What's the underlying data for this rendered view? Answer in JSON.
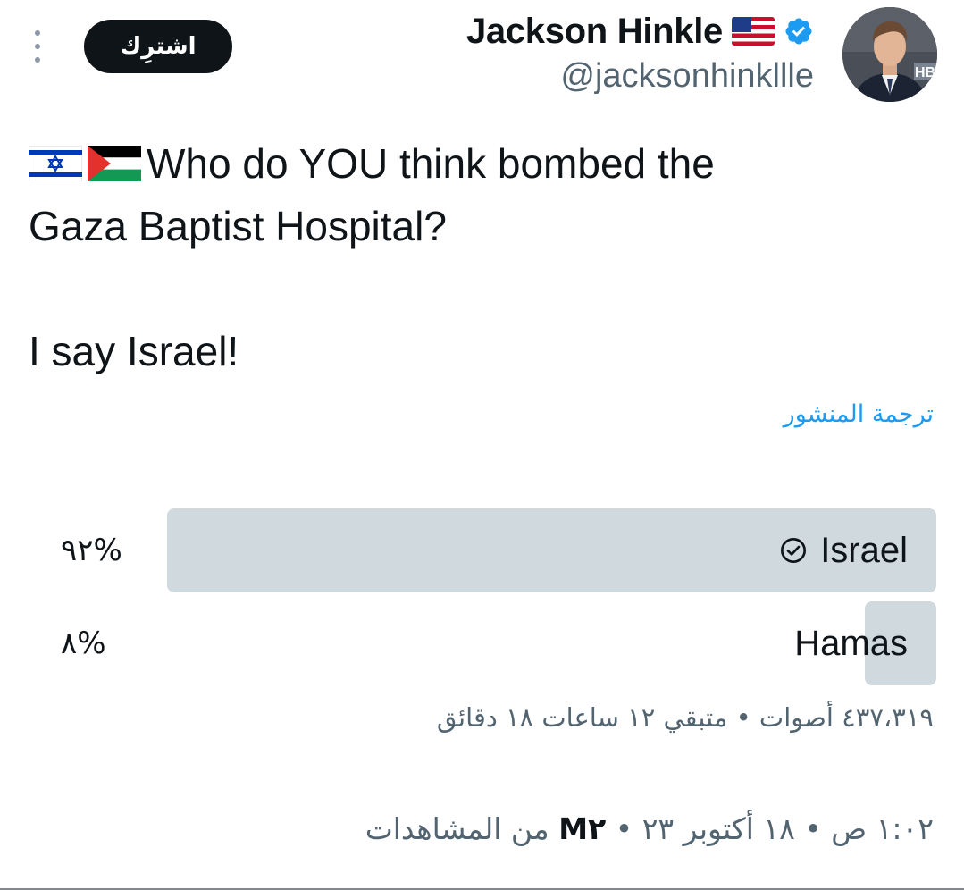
{
  "header": {
    "subscribe_label": "اشترِك",
    "display_name": "Jackson Hinkle",
    "handle": "@jacksonhinkllle",
    "avatar_badge": "HB"
  },
  "tweet": {
    "text_line_1": "Who do YOU think bombed the",
    "text_line_2": "Gaza Baptist Hospital?",
    "text_line_3": "I say Israel!",
    "translate_label": "ترجمة المنشور"
  },
  "poll": {
    "options": [
      {
        "label": "Israel",
        "percent_label": "%٩٢",
        "percent": 92,
        "selected": true
      },
      {
        "label": "Hamas",
        "percent_label": "%٨",
        "percent": 8,
        "selected": false
      }
    ],
    "meta": "٤٣٧،٣١٩ أصوات • متبقي ١٢ ساعات ١٨ دقائق"
  },
  "timestamp": {
    "time_date": "١:٠٢ ص • ١٨ أكتوبر ٢٣",
    "separator": "•",
    "views_count": "M٢",
    "views_label": "من المشاهدات"
  },
  "colors": {
    "accent": "#1d9bf0",
    "poll_bar": "#cfd9de",
    "secondary_text": "#536471"
  },
  "icons": [
    "more-vertical-icon",
    "us-flag-icon",
    "verified-badge-icon",
    "israel-flag-icon",
    "palestine-flag-icon",
    "check-circle-icon"
  ]
}
